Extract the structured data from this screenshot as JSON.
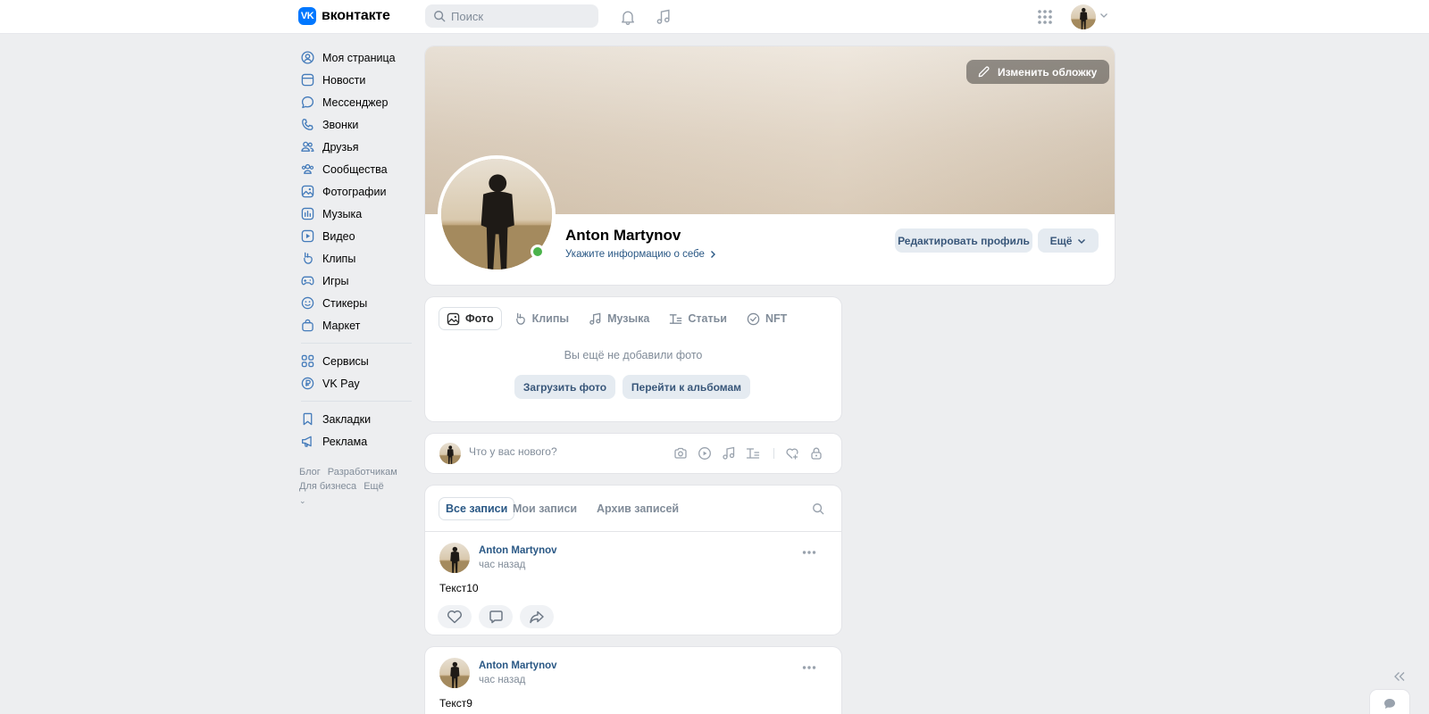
{
  "header": {
    "logo_mark": "VK",
    "logo_text": "вконтакте",
    "search_placeholder": "Поиск"
  },
  "sidebar": {
    "items": [
      {
        "label": "Моя страница",
        "icon": "user-circle-icon"
      },
      {
        "label": "Новости",
        "icon": "newsfeed-icon"
      },
      {
        "label": "Мессенджер",
        "icon": "message-icon"
      },
      {
        "label": "Звонки",
        "icon": "phone-icon"
      },
      {
        "label": "Друзья",
        "icon": "friends-icon"
      },
      {
        "label": "Сообщества",
        "icon": "communities-icon"
      },
      {
        "label": "Фотографии",
        "icon": "photo-icon"
      },
      {
        "label": "Музыка",
        "icon": "music-icon"
      },
      {
        "label": "Видео",
        "icon": "video-icon"
      },
      {
        "label": "Клипы",
        "icon": "clips-icon"
      },
      {
        "label": "Игры",
        "icon": "gamepad-icon"
      },
      {
        "label": "Стикеры",
        "icon": "smile-icon"
      },
      {
        "label": "Маркет",
        "icon": "market-bag-icon"
      }
    ],
    "items2": [
      {
        "label": "Сервисы",
        "icon": "services-grid-icon"
      },
      {
        "label": "VK Pay",
        "icon": "vkpay-icon"
      }
    ],
    "items3": [
      {
        "label": "Закладки",
        "icon": "bookmark-icon"
      },
      {
        "label": "Реклама",
        "icon": "megaphone-icon"
      }
    ],
    "footer": {
      "blog": "Блог",
      "developers": "Разработчикам",
      "business": "Для бизнеса",
      "more": "Ещё"
    }
  },
  "profile": {
    "change_cover": "Изменить обложку",
    "name": "Anton Martynov",
    "info_link": "Укажите информацию о себе",
    "edit_button": "Редактировать профиль",
    "more_button": "Ещё"
  },
  "media": {
    "tabs": [
      {
        "label": "Фото",
        "icon": "photo-icon"
      },
      {
        "label": "Клипы",
        "icon": "clips-icon"
      },
      {
        "label": "Музыка",
        "icon": "music-icon"
      },
      {
        "label": "Статьи",
        "icon": "article-icon"
      },
      {
        "label": "NFT",
        "icon": "nft-check-icon"
      }
    ],
    "empty_text": "Вы ещё не добавили фото",
    "upload_button": "Загрузить фото",
    "albums_button": "Перейти к альбомам"
  },
  "composer": {
    "placeholder": "Что у вас нового?"
  },
  "wall": {
    "tabs": [
      "Все записи",
      "Мои записи",
      "Архив записей"
    ]
  },
  "posts": [
    {
      "author": "Anton Martynov",
      "time": "час назад",
      "text": "Текст10"
    },
    {
      "author": "Anton Martynov",
      "time": "час назад",
      "text": "Текст9"
    }
  ],
  "colors": {
    "accent": "#0077ff",
    "link": "#2a5885",
    "online": "#4bb34b"
  }
}
